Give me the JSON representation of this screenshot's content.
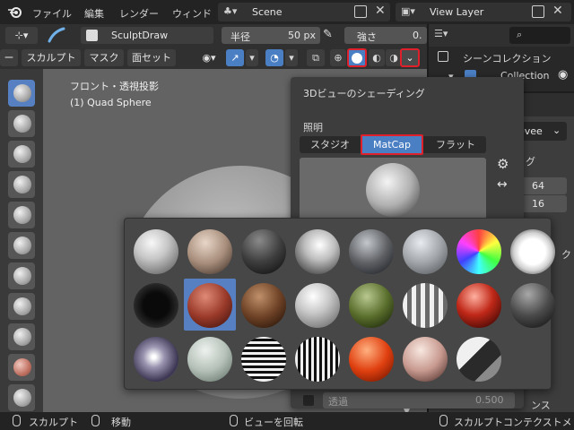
{
  "menubar": {
    "items": [
      "ファイル",
      "編集",
      "レンダー",
      "ウィンド"
    ],
    "scene": "Scene",
    "view_layer": "View Layer"
  },
  "toolheader": {
    "brush_name": "SculptDraw",
    "radius_label": "半径",
    "radius_value": "50 px",
    "strength_label": "強さ",
    "strength_value": "0."
  },
  "modebar": {
    "items": [
      "ー",
      "スカルプト",
      "マスク",
      "面セット"
    ]
  },
  "viewport": {
    "view_name": "フロント・透視投影",
    "object_name": "(1) Quad Sphere"
  },
  "outliner": {
    "scene_collection": "シーンコレクション",
    "collection": "Collection"
  },
  "right_panel": {
    "engine": "evee",
    "tab_label": "グ",
    "resolution_x": "64",
    "resolution_y": "16",
    "side_label_1": "ク",
    "side_label_2": "ンス"
  },
  "shading_popover": {
    "title": "3Dビューのシェーディング",
    "lighting_label": "照明",
    "lighting_options": [
      "スタジオ",
      "MatCap",
      "フラット"
    ],
    "selected_lighting": "MatCap",
    "opacity_label": "透過",
    "opacity_value": "0.500"
  },
  "statusbar": {
    "items": [
      "スカルプト",
      "移動",
      "ビューを回転",
      "スカルプトコンテクストメ"
    ]
  }
}
